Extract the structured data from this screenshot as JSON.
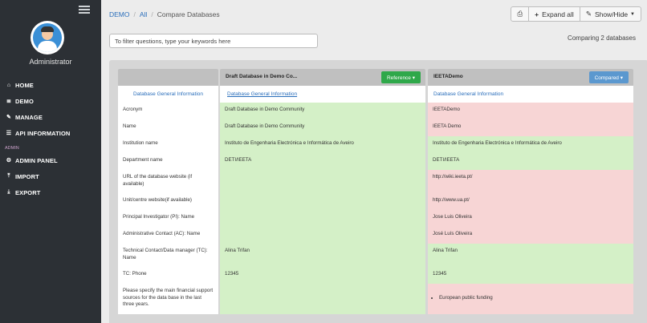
{
  "sidebar": {
    "admin_name": "Administrator",
    "items": [
      {
        "icon": "home-icon",
        "glyph": "⌂",
        "label": "HOME"
      },
      {
        "icon": "database-icon",
        "glyph": "≣",
        "label": "DEMO"
      },
      {
        "icon": "wrench-icon",
        "glyph": "✎",
        "label": "MANAGE"
      },
      {
        "icon": "list-icon",
        "glyph": "☰",
        "label": "API INFORMATION"
      }
    ],
    "section_label": "ADMIN",
    "admin_items": [
      {
        "icon": "cogs-icon",
        "glyph": "⚙",
        "label": "ADMIN PANEL"
      },
      {
        "icon": "upload-icon",
        "glyph": "⤒",
        "label": "IMPORT"
      },
      {
        "icon": "download-icon",
        "glyph": "⤓",
        "label": "EXPORT"
      }
    ]
  },
  "breadcrumb": {
    "root": "DEMO",
    "all": "All",
    "current": "Compare Databases"
  },
  "toolbar": {
    "print_glyph": "⎙",
    "expand_glyph": "+",
    "expand_label": "Expand all",
    "showhide_glyph": "✎",
    "showhide_label": "Show/Hide"
  },
  "search": {
    "placeholder": "To filter questions, type your keywords here"
  },
  "comparing_text": "Comparing 2 databases",
  "compare": {
    "reference": {
      "title": "Draft Database in Demo Co...",
      "button": "Reference ▾"
    },
    "compared": {
      "title": "IEETADemo",
      "button": "Compared ▾"
    },
    "section": "Database General Information",
    "rows": [
      {
        "q": "Acronym",
        "ref": "Draft Database in Demo Community",
        "cmp": "IEETADemo",
        "same": false,
        "h": 21
      },
      {
        "q": "Name",
        "ref": "Draft Database in Demo Community",
        "cmp": "IEETA Demo",
        "same": false,
        "h": 21
      },
      {
        "q": "Institution name",
        "ref": "Instituto de Engenharia Electrónica e Informática de Aveiro",
        "cmp": "Instituto de Engenharia Electrónica e Informática de Aveiro",
        "same": true,
        "h": 21
      },
      {
        "q": "Department name",
        "ref": "DETI/IEETA",
        "cmp": "DETI/IEETA",
        "same": true,
        "h": 21
      },
      {
        "q": "URL of the database website (if available)",
        "ref": "",
        "cmp": "http://wiki.ieeta.pt/",
        "same": false,
        "h": 29
      },
      {
        "q": "Unit/centre website(if available)",
        "ref": "",
        "cmp": "http://www.ua.pt/",
        "same": false,
        "h": 21
      },
      {
        "q": "Principal Investigator (PI): Name",
        "ref": "",
        "cmp": "Jose Luis Oliveira",
        "same": false,
        "h": 21
      },
      {
        "q": "Administrative Contact (AC): Name",
        "ref": "",
        "cmp": "José Luís Oliveira",
        "same": false,
        "h": 21
      },
      {
        "q": "Technical Contact/Data manager (TC): Name",
        "ref": "Alina Trifan",
        "cmp": "Alina Trifan",
        "same": true,
        "h": 29
      },
      {
        "q": "TC: Phone",
        "ref": "12345",
        "cmp": "12345",
        "same": true,
        "h": 21
      },
      {
        "q": "Please specify the main financial support sources for the data base in the last three years.",
        "ref": "",
        "cmp": "European public funding",
        "same": false,
        "h": 38
      }
    ]
  }
}
